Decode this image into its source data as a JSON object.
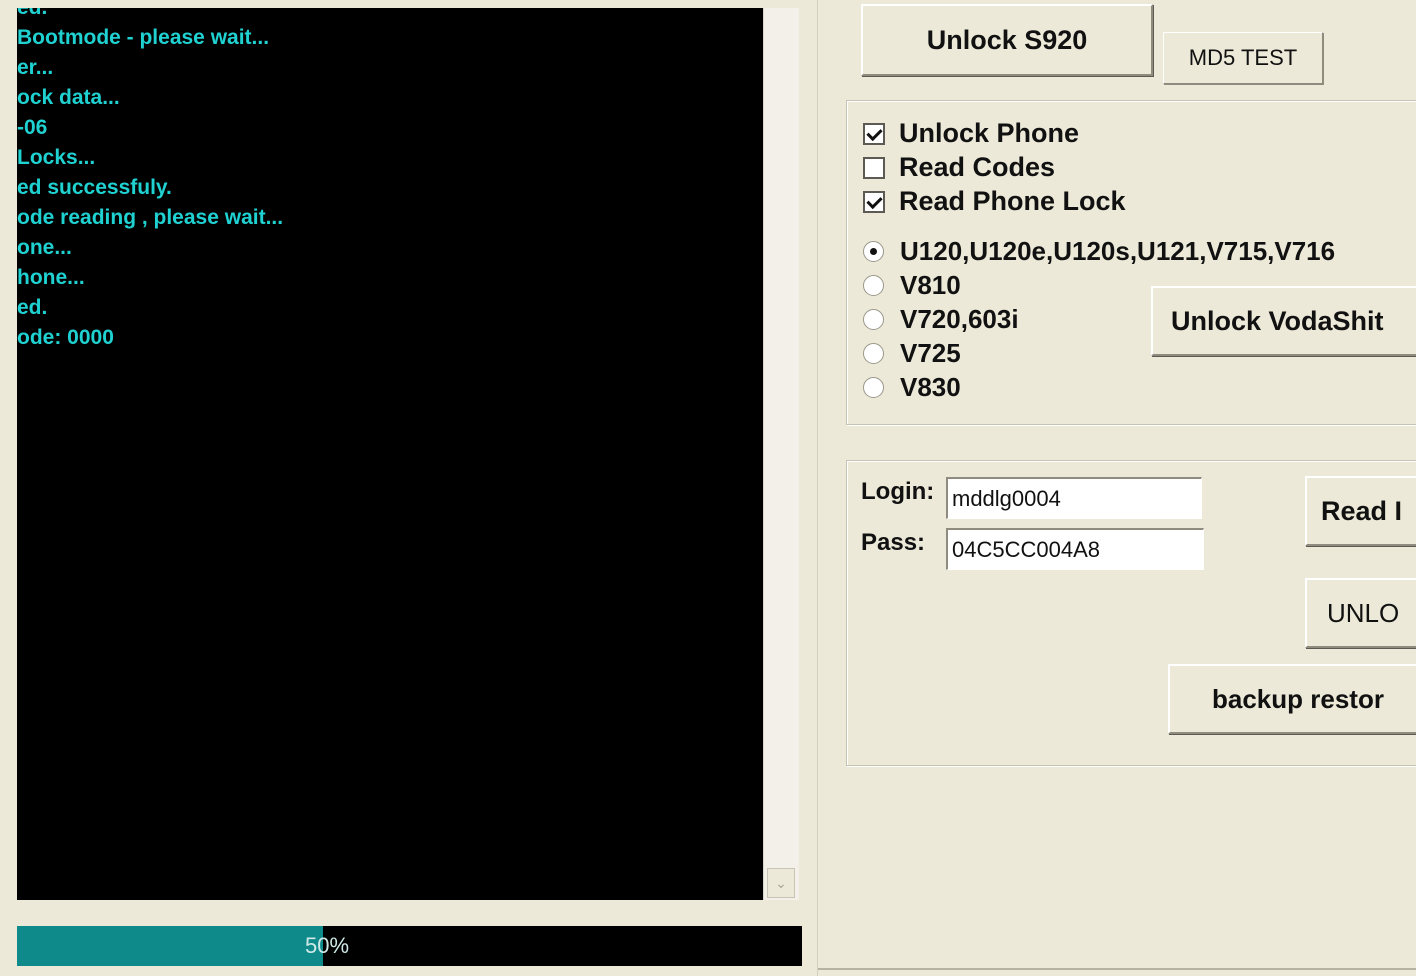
{
  "log": {
    "lines": [
      "ed.",
      "Bootmode - please wait...",
      "er...",
      "ock data...",
      "-06",
      "Locks...",
      "ed successfuly.",
      "ode reading , please wait...",
      "one...",
      "hone...",
      "ed.",
      "ode: 0000"
    ]
  },
  "progress": {
    "value": 0.39,
    "text": "50%"
  },
  "buttons": {
    "unlock_s920": "Unlock S920",
    "md5_test": "MD5 TEST",
    "unlock_vodashit": "Unlock VodaShit",
    "read": "Read I",
    "unlock": "UNLO",
    "backup_restore": "backup restor"
  },
  "checkboxes": [
    {
      "label": "Unlock Phone",
      "checked": true
    },
    {
      "label": "Read Codes",
      "checked": false
    },
    {
      "label": "Read Phone Lock",
      "checked": true
    }
  ],
  "models": [
    {
      "label": "U120,U120e,U120s,U121,V715,V716",
      "selected": true
    },
    {
      "label": "V810",
      "selected": false
    },
    {
      "label": "V720,603i",
      "selected": false
    },
    {
      "label": "V725",
      "selected": false
    },
    {
      "label": "V830",
      "selected": false
    }
  ],
  "credentials": {
    "login_label": "Login:",
    "login_value": "mddlg0004",
    "pass_label": "Pass:",
    "pass_value": "04C5CC004A8"
  },
  "colors": {
    "console_bg": "#000000",
    "console_text": "#1fd1d1",
    "progress_fill": "#0f8a8a",
    "window_bg": "#ece9d8"
  }
}
